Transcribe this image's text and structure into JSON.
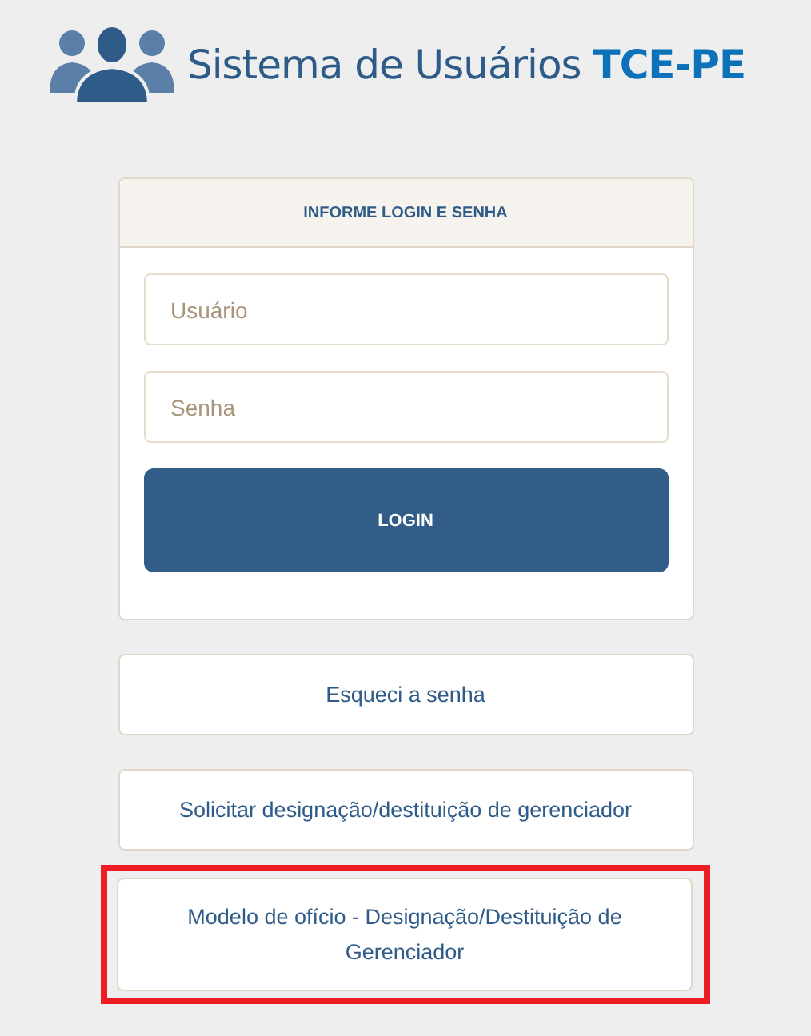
{
  "header": {
    "title": "Sistema de Usuários",
    "title_accent": "TCE-PE"
  },
  "login_panel": {
    "heading": "INFORME LOGIN E SENHA",
    "username": {
      "placeholder": "Usuário"
    },
    "password": {
      "placeholder": "Senha"
    },
    "submit": "LOGIN"
  },
  "links": [
    {
      "label": "Esqueci a senha",
      "highlighted": false
    },
    {
      "label": "Solicitar designação/destituição de gerenciador",
      "highlighted": false
    },
    {
      "label": "Modelo de ofício - Designação/Destituição de Gerenciador",
      "highlighted": true
    }
  ]
}
